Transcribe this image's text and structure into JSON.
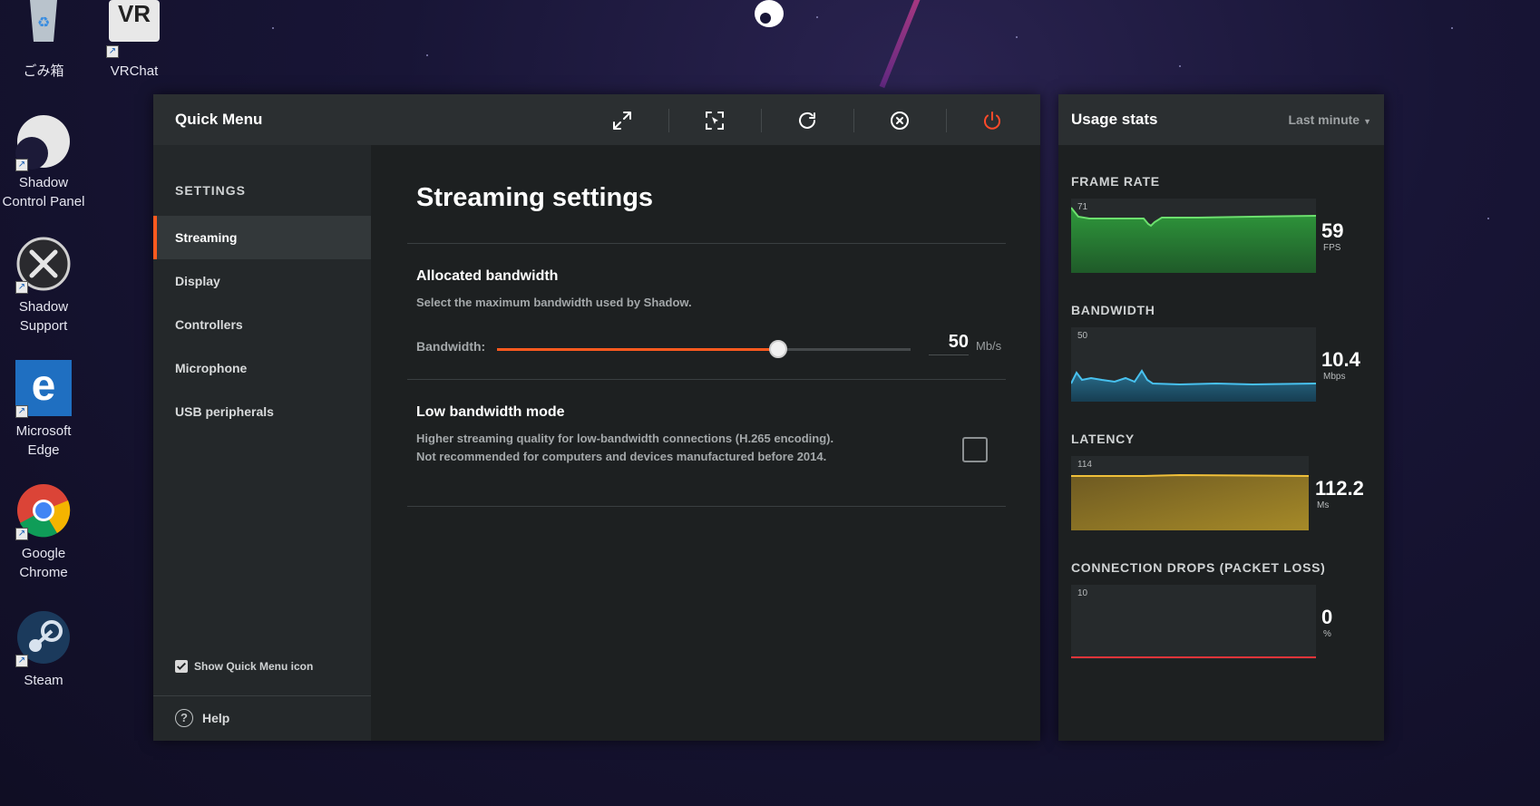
{
  "desktop": {
    "icons": [
      {
        "label": "ごみ箱",
        "icon": "recycle-bin-icon"
      },
      {
        "label": "VRChat",
        "icon": "vrchat-icon",
        "icon_text": "VR"
      },
      {
        "label": "Shadow Control Panel",
        "icon": "shadow-icon"
      },
      {
        "label": "Shadow Support",
        "icon": "support-tools-icon"
      },
      {
        "label": "Microsoft Edge",
        "icon": "edge-icon",
        "icon_text": "e"
      },
      {
        "label": "Google Chrome",
        "icon": "chrome-icon"
      },
      {
        "label": "Steam",
        "icon": "steam-icon"
      }
    ]
  },
  "quick_menu": {
    "title": "Quick Menu",
    "toolbar": [
      {
        "icon": "fullscreen-icon",
        "color": "#ffffff"
      },
      {
        "icon": "capture-cursor-icon",
        "color": "#ffffff"
      },
      {
        "icon": "refresh-icon",
        "color": "#ffffff"
      },
      {
        "icon": "close-circle-icon",
        "color": "#ffffff"
      },
      {
        "icon": "power-icon",
        "color": "#ff4a2a"
      }
    ],
    "sidebar": {
      "heading": "SETTINGS",
      "items": [
        {
          "label": "Streaming",
          "active": true
        },
        {
          "label": "Display",
          "active": false
        },
        {
          "label": "Controllers",
          "active": false
        },
        {
          "label": "Microphone",
          "active": false
        },
        {
          "label": "USB peripherals",
          "active": false
        }
      ],
      "show_icon_label": "Show Quick Menu icon",
      "show_icon_checked": true,
      "help_label": "Help"
    },
    "main": {
      "title": "Streaming settings",
      "bandwidth": {
        "heading": "Allocated bandwidth",
        "description": "Select the maximum bandwidth used by Shadow.",
        "label": "Bandwidth:",
        "value": "50",
        "unit": "Mb/s",
        "slider_fraction": 0.68
      },
      "low_bandwidth": {
        "heading": "Low bandwidth mode",
        "description": "Higher streaming quality for low-bandwidth connections (H.265 encoding). Not recommended for computers and devices manufactured before 2014.",
        "checked": false
      }
    },
    "accent_color": "#ff5a1f"
  },
  "usage_stats": {
    "title": "Usage stats",
    "period": "Last minute",
    "stats": [
      {
        "label": "FRAME RATE",
        "max": "71",
        "value": "59",
        "unit": "FPS",
        "color": "#3fbf4f"
      },
      {
        "label": "BANDWIDTH",
        "max": "50",
        "value": "10.4",
        "unit": "Mbps",
        "color": "#3aa9d6"
      },
      {
        "label": "LATENCY",
        "max": "114",
        "value": "112.2",
        "unit": "Ms",
        "color": "#d9a92a"
      },
      {
        "label": "CONNECTION DROPS (PACKET LOSS)",
        "max": "10",
        "value": "0",
        "unit": "%",
        "color": "#e0343a"
      }
    ]
  }
}
